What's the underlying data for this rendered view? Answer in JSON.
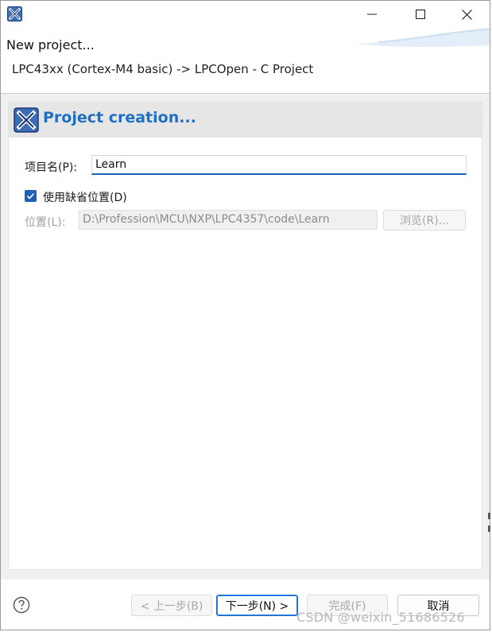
{
  "window": {
    "title_icon": "app-x-icon",
    "controls": {
      "minimize_icon": "minimize-icon",
      "maximize_icon": "maximize-icon",
      "close_icon": "close-icon"
    }
  },
  "header": {
    "title": "New project...",
    "description": "LPC43xx (Cortex-M4 basic) -> LPCOpen - C Project"
  },
  "section": {
    "icon": "project-x-icon",
    "title": "Project creation..."
  },
  "form": {
    "name_label": "项目名(P):",
    "name_value": "Learn",
    "use_default_label": "使用缺省位置(D)",
    "use_default_checked": true,
    "location_label": "位置(L):",
    "location_value": "D:\\Profession\\MCU\\NXP\\LPC4357\\code\\Learn",
    "browse_label": "浏览(R)..."
  },
  "buttons": {
    "help_icon": "help-icon",
    "back": "< 上一步(B)",
    "next": "下一步(N) >",
    "finish": "完成(F)",
    "cancel": "取消"
  },
  "watermark": "CSDN @weixin_51686526",
  "colors": {
    "accent": "#1f6fc2",
    "checkbox": "#1f5fb8",
    "section_bg": "#e6e6e6",
    "content_bg": "#f0f0f0"
  }
}
